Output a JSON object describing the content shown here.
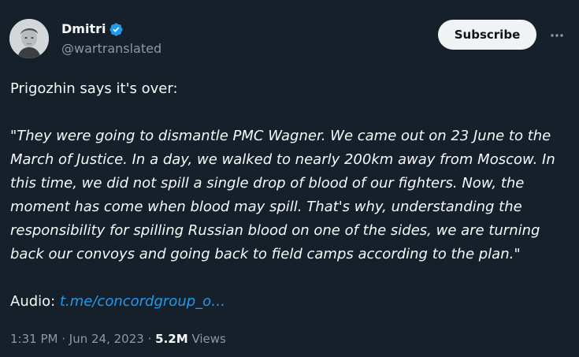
{
  "author": {
    "display_name": "Dmitri",
    "handle": "@wartranslated",
    "verified": true
  },
  "actions": {
    "subscribe_label": "Subscribe",
    "more_icon": "more-horizontal-icon"
  },
  "tweet": {
    "intro": "Prigozhin says it's over:",
    "quote": "\"They were going to dismantle PMC Wagner. We came out on 23 June to the March of Justice. In a day, we walked to nearly 200km away from Moscow. In this time, we did not spill a single drop of blood of our fighters. Now, the moment has come when blood may spill. That's why, understanding the responsibility for spilling Russian blood on one of the sides, we are turning back our convoys and going back to field camps according to the plan.\"",
    "audio_label": "Audio:",
    "audio_link": "t.me/concordgroup_o…"
  },
  "meta": {
    "time": "1:31 PM",
    "separator": "·",
    "date": "Jun 24, 2023",
    "views_count": "5.2M",
    "views_label": "Views"
  },
  "colors": {
    "background": "#15202b",
    "text": "#f7f9f9",
    "secondary_text": "#8b98a5",
    "link": "#1d9bf0",
    "verified_badge": "#1d9bf0",
    "subscribe_bg": "#eff3f4"
  }
}
